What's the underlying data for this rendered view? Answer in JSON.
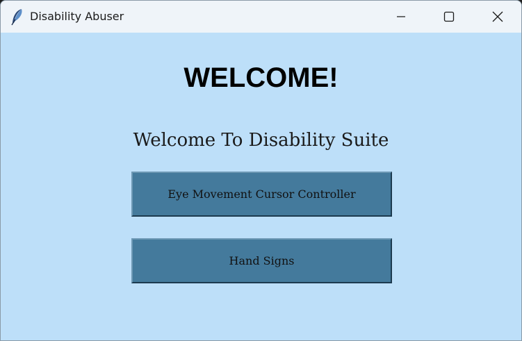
{
  "window": {
    "title": "Disability Abuser",
    "app_icon": "feather-icon",
    "controls": {
      "minimize_icon": "minimize-icon",
      "maximize_icon": "maximize-icon",
      "close_icon": "close-icon"
    }
  },
  "main": {
    "heading": "WELCOME!",
    "subheading": "Welcome To Disability Suite",
    "buttons": [
      {
        "label": "Eye Movement Cursor Controller"
      },
      {
        "label": "Hand Signs"
      }
    ]
  },
  "colors": {
    "background": "#bddff9",
    "titlebar": "#eff4f9",
    "button": "#447a9c"
  }
}
